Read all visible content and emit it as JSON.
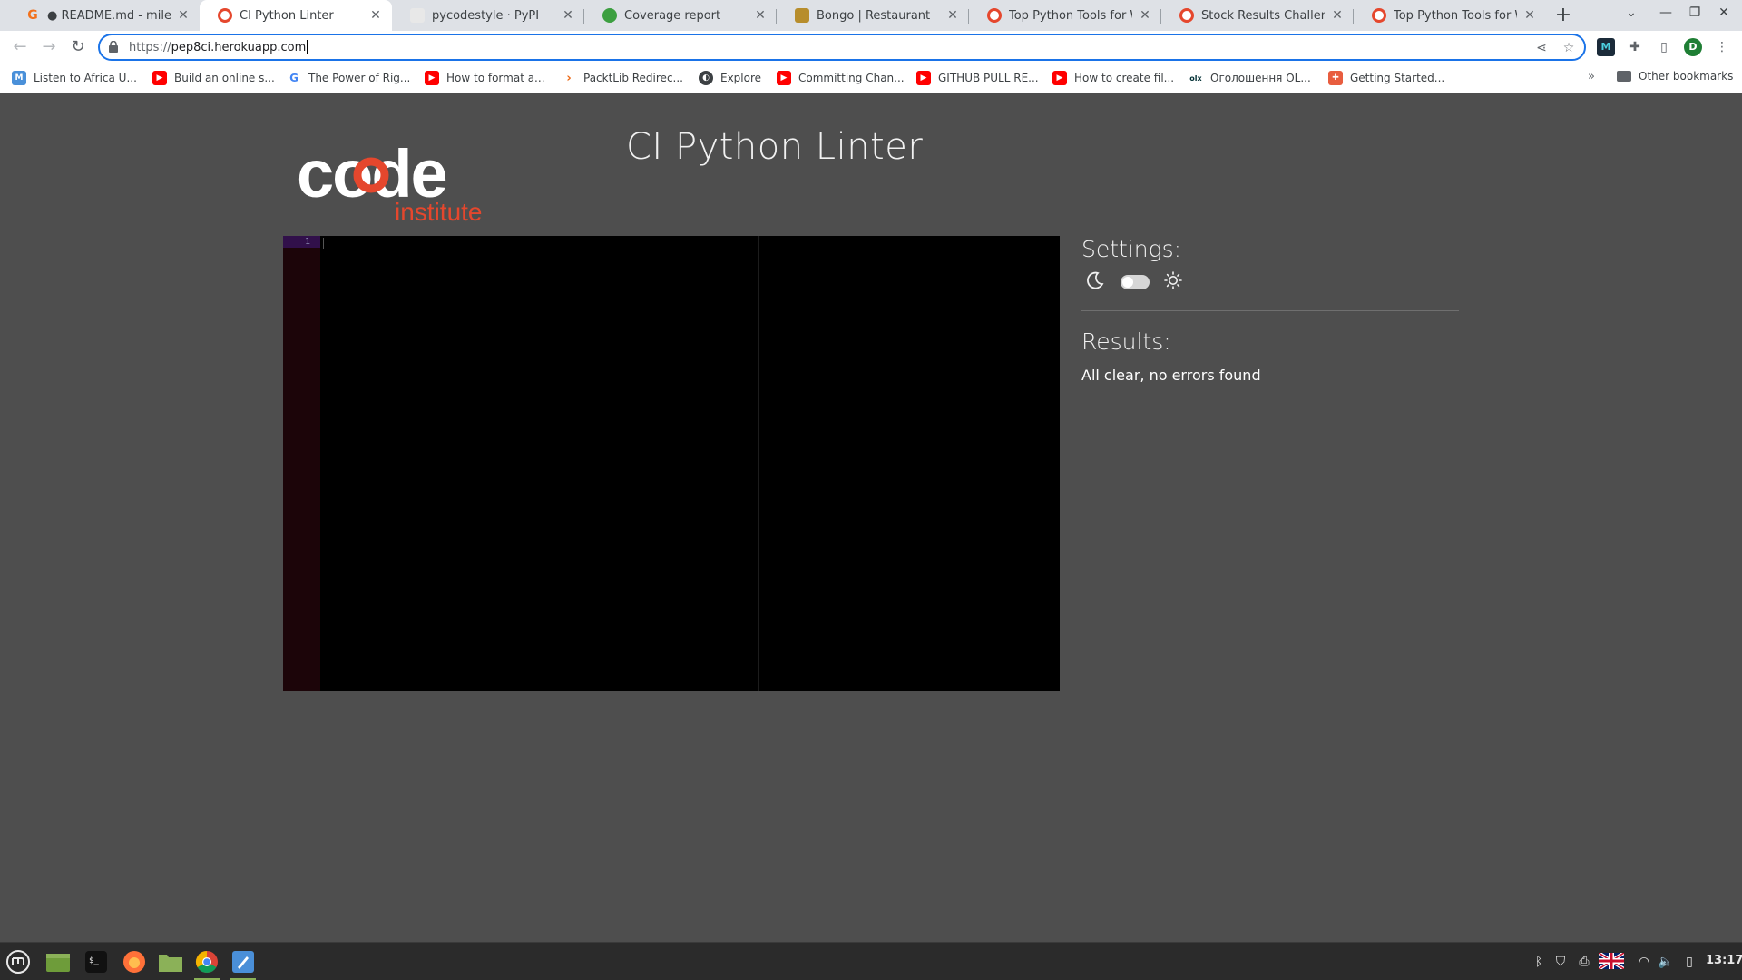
{
  "browser": {
    "tabs": [
      {
        "title": "● README.md - milestone",
        "active": false,
        "favicon": "gitpod-icon",
        "color": "#f2711c"
      },
      {
        "title": "CI Python Linter",
        "active": true,
        "favicon": "ci-icon",
        "color": "#e5472d"
      },
      {
        "title": "pycodestyle · PyPI",
        "active": false,
        "favicon": "pypi-icon",
        "color": "#cccccc"
      },
      {
        "title": "Coverage report",
        "active": false,
        "favicon": "coverage-icon",
        "color": "#3c9f40"
      },
      {
        "title": "Bongo | Restaurant",
        "active": false,
        "favicon": "restaurant-icon",
        "color": "#b78d2c"
      },
      {
        "title": "Top Python Tools for We",
        "active": false,
        "favicon": "ci-icon",
        "color": "#e5472d"
      },
      {
        "title": "Stock Results Challenge",
        "active": false,
        "favicon": "ci-icon",
        "color": "#e5472d"
      },
      {
        "title": "Top Python Tools for We",
        "active": false,
        "favicon": "ci-icon",
        "color": "#e5472d"
      }
    ],
    "url_scheme": "https://",
    "url_host": "pep8ci.herokuapp.com",
    "profile_initial": "D",
    "extension_label": "M",
    "bookmarks": [
      {
        "label": "Listen to Africa U...",
        "icon": "m-icon",
        "color": "#4a90d9"
      },
      {
        "label": "Build an online s...",
        "icon": "youtube-icon",
        "color": "#ff0000"
      },
      {
        "label": "The Power of Rig...",
        "icon": "google-icon",
        "color": "#4285f4"
      },
      {
        "label": "How to format a...",
        "icon": "youtube-icon",
        "color": "#ff0000"
      },
      {
        "label": "PacktLib Redirec...",
        "icon": "packt-icon",
        "color": "#ec6611"
      },
      {
        "label": "Explore",
        "icon": "globe-icon",
        "color": "#3c4043"
      },
      {
        "label": "Committing Chan...",
        "icon": "youtube-icon",
        "color": "#ff0000"
      },
      {
        "label": "GITHUB PULL RE...",
        "icon": "youtube-icon",
        "color": "#ff0000"
      },
      {
        "label": "How to create fil...",
        "icon": "youtube-icon",
        "color": "#ff0000"
      },
      {
        "label": "Оголошення OL...",
        "icon": "olx-icon",
        "color": "#002f34"
      },
      {
        "label": "Getting Started...",
        "icon": "heroku-icon",
        "color": "#e85d3f"
      }
    ],
    "more_bookmarks": "»",
    "other_bookmarks": "Other bookmarks"
  },
  "page": {
    "logo_top": "code",
    "logo_bottom": "institute",
    "title": "CI Python Linter",
    "editor": {
      "line_number": "1"
    },
    "settings_title": "Settings:",
    "results_title": "Results:",
    "results_text": "All clear, no errors found",
    "colors": {
      "background": "#4e4e4e",
      "accent": "#e5472d",
      "gutter": "#1c0509"
    }
  },
  "taskbar": {
    "apps": [
      "mint-menu-icon",
      "show-desktop-icon",
      "terminal-icon",
      "firefox-icon",
      "files-icon",
      "chrome-icon",
      "text-editor-icon"
    ],
    "clock": "13:17"
  }
}
